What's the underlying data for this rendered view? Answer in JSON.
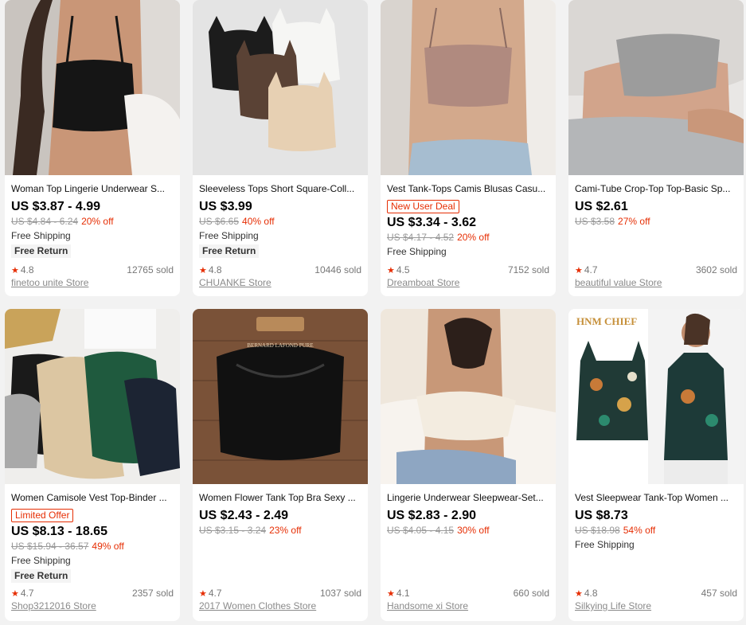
{
  "products": [
    {
      "title": "Woman Top Lingerie Underwear S...",
      "price": "US $3.87 - 4.99",
      "original": "US $4.84 - 6.24",
      "discount": "20% off",
      "shipping": "Free Shipping",
      "free_return": "Free Return",
      "rating": "4.8",
      "sold": "12765 sold",
      "store": "finetoo unite Store",
      "image": "woman-black-crop-top"
    },
    {
      "title": "Sleeveless Tops Short Square-Coll...",
      "price": "US $3.99",
      "original": "US $6.65",
      "discount": "40% off",
      "shipping": "Free Shipping",
      "free_return": "Free Return",
      "rating": "4.8",
      "sold": "10446 sold",
      "store": "CHUANKE Store",
      "image": "four-crop-tops-flat-lay"
    },
    {
      "title": "Vest Tank-Tops Camis Blusas Casu...",
      "tag": "New User Deal",
      "price": "US $3.34 - 3.62",
      "original": "US $4.17 - 4.52",
      "discount": "20% off",
      "shipping": "Free Shipping",
      "rating": "4.5",
      "sold": "7152 sold",
      "store": "Dreamboat Store",
      "image": "woman-pink-cami"
    },
    {
      "title": "Cami-Tube Crop-Top Top-Basic Sp...",
      "price": "US $2.61",
      "original": "US $3.58",
      "discount": "27% off",
      "rating": "4.7",
      "sold": "3602 sold",
      "store": "beautiful value Store",
      "image": "woman-grey-tube-top"
    },
    {
      "title": "Women Camisole Vest Top-Binder ...",
      "tag": "Limited Offer",
      "price": "US $8.13 - 18.65",
      "original": "US $15.94 - 36.57",
      "discount": "49% off",
      "shipping": "Free Shipping",
      "free_return": "Free Return",
      "rating": "4.7",
      "sold": "2357 sold",
      "store": "Shop3212016 Store",
      "image": "satin-camisoles"
    },
    {
      "title": "Women Flower Tank Top Bra Sexy ...",
      "price": "US $2.43 - 2.49",
      "original": "US $3.15 - 3.24",
      "discount": "23% off",
      "rating": "4.7",
      "sold": "1037 sold",
      "store": "2017 Women Clothes Store",
      "image": "black-lace-bralette",
      "image_text": "BERNARD LAFOND PURE"
    },
    {
      "title": "Lingerie Underwear Sleepwear-Set...",
      "price": "US $2.83 - 2.90",
      "original": "US $4.05 - 4.15",
      "discount": "30% off",
      "rating": "4.1",
      "sold": "660 sold",
      "store": "Handsome xi Store",
      "image": "woman-white-lace-bralette"
    },
    {
      "title": "Vest Sleepwear Tank-Top Women ...",
      "price": "US $8.73",
      "original": "US $18.98",
      "discount": "54% off",
      "shipping": "Free Shipping",
      "rating": "4.8",
      "sold": "457 sold",
      "store": "Silkying Life Store",
      "image": "floral-print-camisole",
      "brand_logo": "HNM CHIEF"
    }
  ]
}
